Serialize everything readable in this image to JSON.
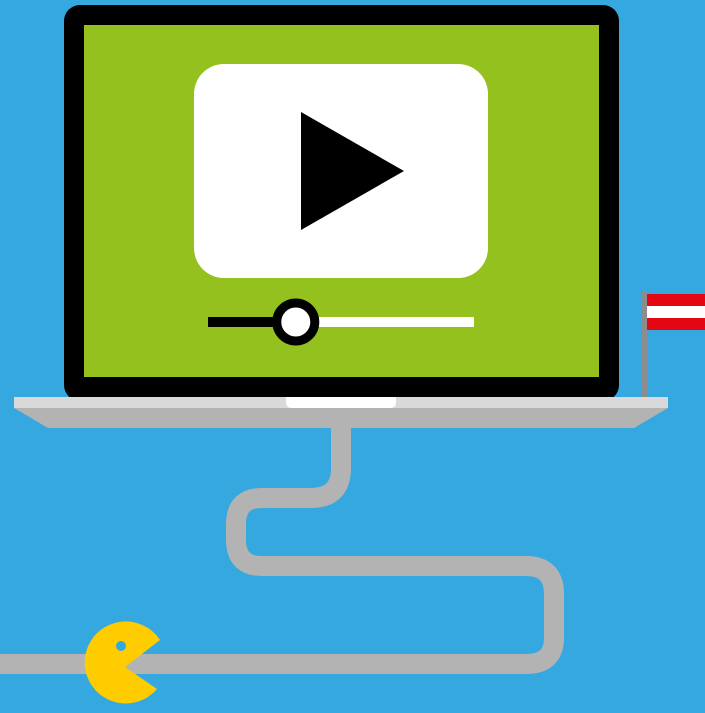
{
  "colors": {
    "background": "#35a8e0",
    "laptop_bezel": "#000000",
    "screen": "#95c11f",
    "player_card": "#ffffff",
    "play_icon": "#000000",
    "progress_played": "#000000",
    "progress_remaining": "#ffffff",
    "laptop_base": "#b3b3b3",
    "laptop_base_top": "#d9d9d9",
    "cable": "#b3b3b3",
    "pacman": "#ffcc00",
    "pacman_eye": "#35a8e0",
    "flag_red": "#e30613",
    "flag_white": "#ffffff",
    "flag_pole": "#8c8c8c"
  },
  "video_player": {
    "play_icon": "play-icon",
    "progress": 0.33
  },
  "icons": {
    "play": "play-icon",
    "flag": "austria-flag-icon",
    "pacman": "pacman-icon"
  }
}
